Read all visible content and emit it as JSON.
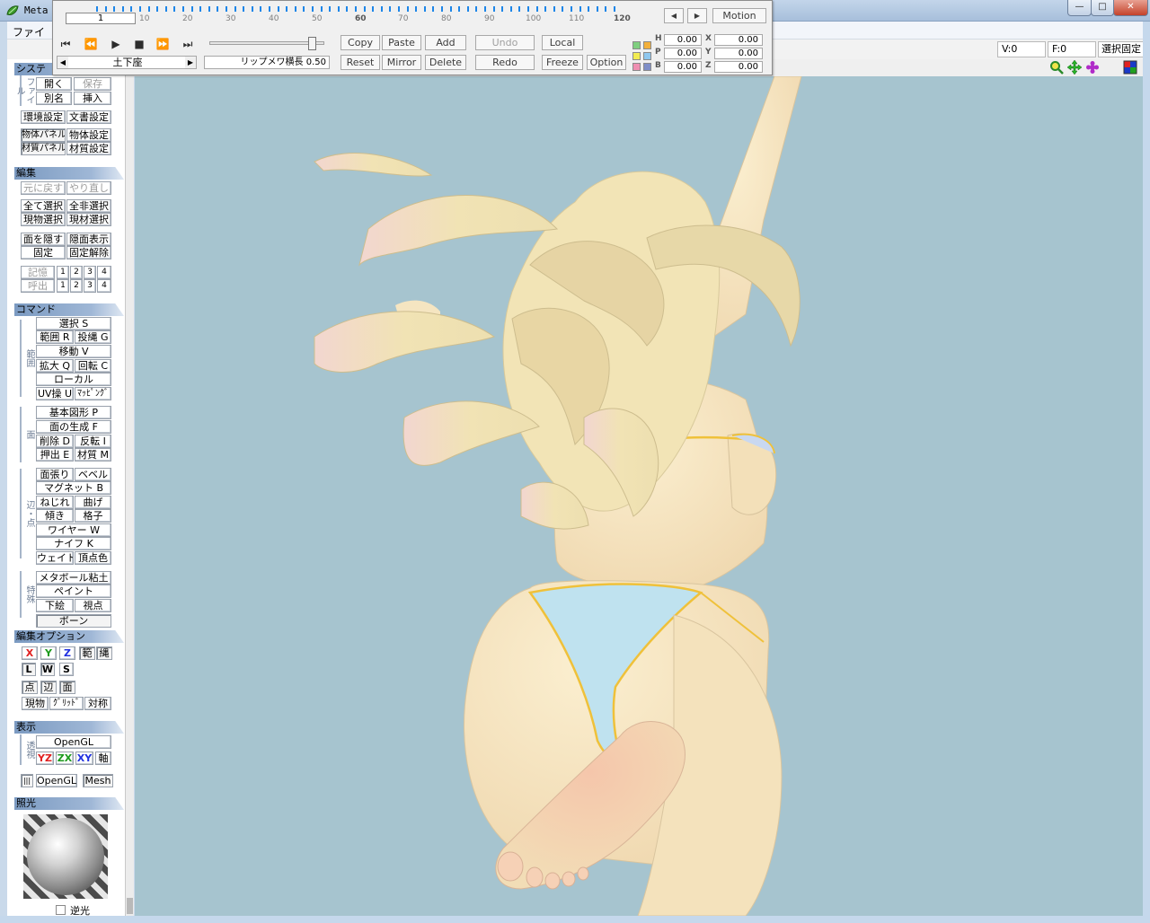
{
  "window": {
    "title": "Meta",
    "minimize": "—",
    "maximize": "□",
    "close": "✕"
  },
  "menu": {
    "file": "ファイ"
  },
  "statusbar": {
    "v": "V:0",
    "f": "F:0",
    "lock": "選択固定"
  },
  "palette": {
    "frame": "1",
    "timeline_labels": [
      "10",
      "20",
      "30",
      "40",
      "50",
      "60",
      "70",
      "80",
      "90",
      "100",
      "110",
      "120"
    ],
    "bone_dropdown": "土下座",
    "lipsync": "リップメワ横長  0.50",
    "buttons": {
      "copy": "Copy",
      "paste": "Paste",
      "add": "Add",
      "undo": "Undo",
      "local": "Local",
      "reset": "Reset",
      "mirror": "Mirror",
      "delete": "Delete",
      "redo": "Redo",
      "freeze": "Freeze",
      "option": "Option",
      "motion": "Motion"
    },
    "hpb": {
      "h_label": "H",
      "p_label": "P",
      "b_label": "B",
      "h": "0.00",
      "p": "0.00",
      "b": "0.00"
    },
    "xyz": {
      "x_label": "X",
      "y_label": "Y",
      "z_label": "Z",
      "x": "0.00",
      "y": "0.00",
      "z": "0.00"
    }
  },
  "leftpanel": {
    "system": {
      "header": "システ",
      "file_label": "ファイル",
      "open": "開く",
      "save": "保存",
      "saveas": "別名",
      "insert": "挿入",
      "env": "環境設定",
      "doc": "文書設定",
      "objpanel": "物体パネル",
      "objset": "物体設定",
      "matpanel": "材質パネル",
      "matset": "材質設定"
    },
    "edit": {
      "header": "編集",
      "undo": "元に戻す",
      "redo": "やり直し",
      "selall": "全て選択",
      "deselall": "全非選択",
      "selobj": "現物選択",
      "selmat": "現材選択",
      "hideface": "面を隠す",
      "showhidden": "隠面表示",
      "fix": "固定",
      "unfix": "固定解除",
      "memory": "記憶",
      "recall": "呼出",
      "slots": [
        "1",
        "2",
        "3",
        "4"
      ]
    },
    "command": {
      "header": "コマンド",
      "range_label": "範囲",
      "select": "選択 S",
      "range": "範囲 R",
      "lasso": "投縄 G",
      "move": "移動 V",
      "scale": "拡大 Q",
      "rotate": "回転 C",
      "local": "ローカル",
      "uv": "UV操 U",
      "mapping": "ﾏｯﾋﾟﾝｸﾞ",
      "face_label": "面",
      "basic": "基本図形 P",
      "genface": "面の生成 F",
      "deletef": "削除 D",
      "invert": "反転 I",
      "extrude": "押出 E",
      "material": "材質 M",
      "edge_label": "辺・点",
      "facecut": "面張り",
      "bevel": "ベベル",
      "magnet": "マグネット B",
      "twist": "ねじれ",
      "bend": "曲げ",
      "tilt": "傾き",
      "lattice": "格子",
      "wire": "ワイヤー W",
      "knife": "ナイフ K",
      "weight": "ウェイト",
      "vcolor": "頂点色",
      "special_label": "特殊",
      "metaball": "メタボール粘土",
      "paint": "ペイント",
      "underlay": "下絵",
      "viewpoint": "視点",
      "bone": "ボーン"
    },
    "editopt": {
      "header": "編集オプション",
      "x": "X",
      "y": "Y",
      "z": "Z",
      "range": "範",
      "lasso": "縄",
      "l": "L",
      "w": "W",
      "s": "S",
      "pt": "点",
      "edge": "辺",
      "face": "面",
      "curobj": "現物",
      "grid": "ｸﾞﾘｯﾄﾞ",
      "sym": "対称"
    },
    "display": {
      "header": "表示",
      "persp_label": "透視",
      "opengl": "OpenGL",
      "yz": "YZ",
      "zx": "ZX",
      "xy": "XY",
      "axis": "軸",
      "triple_label": "|||",
      "opengl2": "OpenGL",
      "mesh": "Mesh"
    },
    "light": {
      "header": "照光",
      "backlight": "逆光"
    }
  },
  "colors": {
    "viewport_bg": "#a6c4cf",
    "skin": "#f6e7c1",
    "hair": "#f2e4b6",
    "bikini": "#bfe2ef",
    "bikini_trim": "#efc13a"
  }
}
